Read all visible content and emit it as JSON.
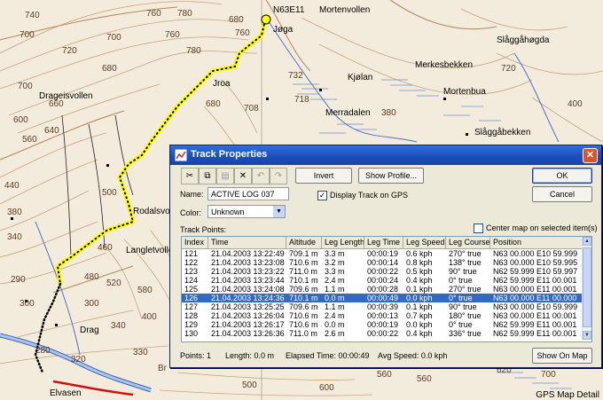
{
  "map": {
    "grid_label": "N63E11",
    "contour_labels": [
      "740",
      "760",
      "700",
      "700",
      "760",
      "780",
      "780",
      "720",
      "680",
      "700",
      "720",
      "680",
      "760",
      "732",
      "718",
      "708",
      "680",
      "600",
      "660",
      "640",
      "560",
      "500",
      "440",
      "380",
      "340",
      "460",
      "480",
      "520",
      "580",
      "300",
      "290",
      "300",
      "400",
      "340",
      "280",
      "500",
      "320",
      "330",
      "Br",
      "500",
      "600",
      "560",
      "560",
      "620",
      "700",
      "380",
      "400"
    ],
    "places": [
      "Mortenvollen",
      "Slåggåhøgda",
      "Kjølan",
      "Merkesbekken",
      "Drageisvollen",
      "Mortenbua",
      "Slåggåbekken",
      "Merradalen",
      "Jroa",
      "Rodalsvol",
      "Langletvollen",
      "Drag",
      "Elvasen",
      "Jøga"
    ],
    "detail_label": "GPS Map Detail"
  },
  "dialog": {
    "title": "Track Properties",
    "close_label": "✕",
    "toolbar": [
      {
        "name": "cut-icon",
        "glyph": "✂"
      },
      {
        "name": "copy-icon",
        "glyph": "⧉"
      },
      {
        "name": "paste-icon",
        "glyph": "▤"
      },
      {
        "name": "delete-icon",
        "glyph": "✕"
      },
      {
        "name": "undo-icon",
        "glyph": "↶"
      },
      {
        "name": "redo-icon",
        "glyph": "↷"
      }
    ],
    "invert_label": "Invert",
    "show_profile_label": "Show Profile...",
    "ok_label": "OK",
    "cancel_label": "Cancel",
    "name_label": "Name:",
    "name_value": "ACTIVE LOG 037",
    "display_track_label": "Display Track on GPS",
    "display_track_checked": true,
    "color_label": "Color:",
    "color_value": "Unknown",
    "track_points_label": "Track Points:",
    "center_map_label": "Center map on selected item(s)",
    "center_map_checked": false,
    "columns": [
      "Index",
      "Time",
      "Altitude",
      "Leg Length",
      "Leg Time",
      "Leg Speed",
      "Leg Course",
      "Position"
    ],
    "rows": [
      [
        "121",
        "21.04.2003 13:22:49",
        "709.1 m",
        "3.3 m",
        "00:00:19",
        "0.6 kph",
        "270° true",
        "N63 00.000 E10 59.999"
      ],
      [
        "122",
        "21.04.2003 13:23:08",
        "710.6 m",
        "3.2 m",
        "00:00:14",
        "0.8 kph",
        "138° true",
        "N63 00.000 E10 59.995"
      ],
      [
        "123",
        "21.04.2003 13:23:22",
        "711.0 m",
        "3.3 m",
        "00:00:22",
        "0.5 kph",
        "90° true",
        "N62 59.999 E10 59.997"
      ],
      [
        "124",
        "21.04.2003 13:23:44",
        "710.1 m",
        "2.4 m",
        "00:00:24",
        "0.4 kph",
        "0° true",
        "N62 59.999 E11 00.001"
      ],
      [
        "125",
        "21.04.2003 13:24:08",
        "709.6 m",
        "1.1 m",
        "00:00:28",
        "0.1 kph",
        "270° true",
        "N63 00.000 E11 00.001"
      ],
      [
        "126",
        "21.04.2003 13:24:36",
        "710.1 m",
        "0.0 m",
        "00:00:49",
        "0.0 kph",
        "0° true",
        "N63 00.000 E11 00.000"
      ],
      [
        "127",
        "21.04.2003 13:25:25",
        "709.6 m",
        "1.1 m",
        "00:00:39",
        "0.1 kph",
        "90° true",
        "N63 00.000 E10 59.999"
      ],
      [
        "128",
        "21.04.2003 13:26:04",
        "710.6 m",
        "2.4 m",
        "00:00:13",
        "0.7 kph",
        "180° true",
        "N63 00.000 E11 00.001"
      ],
      [
        "129",
        "21.04.2003 13:26:17",
        "710.6 m",
        "0.0 m",
        "00:00:19",
        "0.0 kph",
        "0° true",
        "N62 59.999 E11 00.001"
      ],
      [
        "130",
        "21.04.2003 13:26:36",
        "711.0 m",
        "2.6 m",
        "00:00:22",
        "0.4 kph",
        "336° true",
        "N62 59.999 E11 00.001"
      ]
    ],
    "selected_row": 5,
    "status": {
      "points": "Points: 1",
      "length": "Length: 0.0 m",
      "elapsed": "Elapsed Time: 00:00:49",
      "avg_speed": "Avg Speed: 0.0 kph"
    },
    "show_on_map_label": "Show On Map"
  }
}
